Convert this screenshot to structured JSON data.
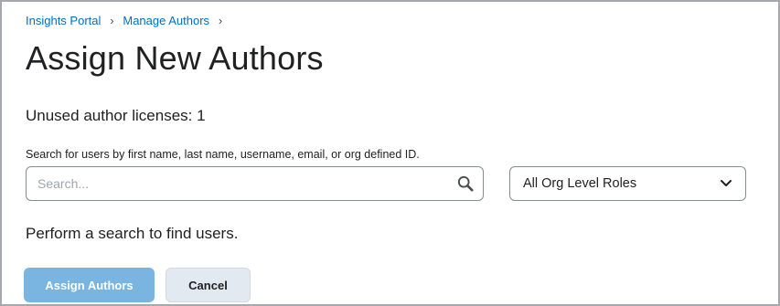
{
  "breadcrumb": {
    "items": [
      {
        "label": "Insights Portal"
      },
      {
        "label": "Manage Authors"
      }
    ],
    "separator": "›"
  },
  "page": {
    "title": "Assign New Authors"
  },
  "licenses": {
    "text": "Unused author licenses: 1"
  },
  "search": {
    "help_text": "Search for users by first name, last name, username, email, or org defined ID.",
    "placeholder": "Search...",
    "value": "",
    "icon": "search-icon"
  },
  "role_filter": {
    "selected": "All Org Level Roles",
    "icon": "chevron-down-icon"
  },
  "results": {
    "empty_message": "Perform a search to find users."
  },
  "actions": {
    "assign_label": "Assign Authors",
    "cancel_label": "Cancel"
  },
  "colors": {
    "link": "#006fbf",
    "primary_button": "#7ab4e0",
    "secondary_button": "#e3e9f1",
    "text": "#202122",
    "border": "#868c8f"
  }
}
